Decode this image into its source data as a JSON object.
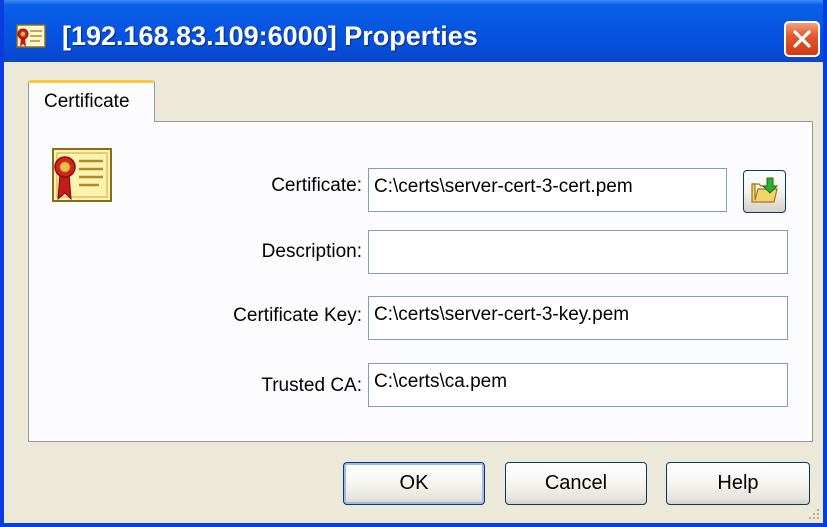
{
  "window": {
    "title": "[192.168.83.109:6000] Properties"
  },
  "tabs": [
    {
      "label": "Certificate",
      "active": true
    }
  ],
  "form": {
    "certificate": {
      "label": "Certificate:",
      "value": "C:\\certs\\server-cert-3-cert.pem"
    },
    "description": {
      "label": "Description:",
      "value": ""
    },
    "certificate_key": {
      "label": "Certificate Key:",
      "value": "C:\\certs\\server-cert-3-key.pem"
    },
    "trusted_ca": {
      "label": "Trusted CA:",
      "value": "C:\\certs\\ca.pem"
    }
  },
  "buttons": {
    "ok": "OK",
    "cancel": "Cancel",
    "help": "Help"
  },
  "icons": {
    "title": "certificate-icon",
    "close": "close-icon",
    "browse": "folder-open-icon",
    "panel": "certificate-icon"
  },
  "colors": {
    "titlebar": "#0757e3",
    "close_button": "#e2582f",
    "window_background": "#ece9d8",
    "tab_accent": "#ffc83c"
  }
}
